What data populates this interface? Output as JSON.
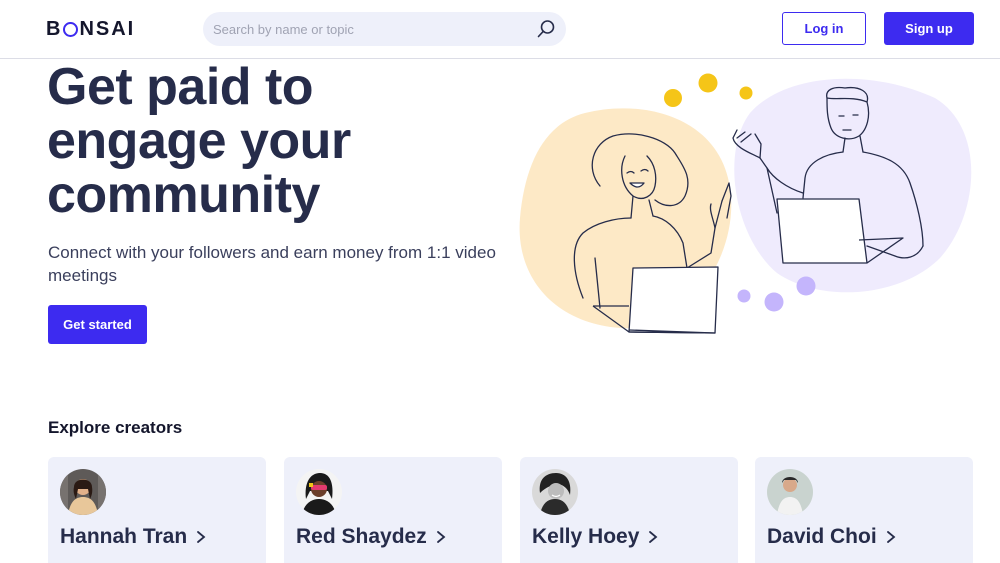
{
  "header": {
    "logo_pre": "B",
    "logo_post": "NSAI",
    "search_placeholder": "Search by name or topic",
    "login_label": "Log in",
    "signup_label": "Sign up"
  },
  "hero": {
    "title_line1": "Get paid to",
    "title_line2": "engage your",
    "title_line3": "community",
    "subtitle": "Connect with your followers and earn money from 1:1 video meetings",
    "cta_label": "Get started"
  },
  "explore": {
    "title": "Explore creators",
    "creators": [
      {
        "name": "Hannah Tran"
      },
      {
        "name": "Red Shaydez"
      },
      {
        "name": "Kelly Hoey"
      },
      {
        "name": "David Choi"
      }
    ]
  },
  "colors": {
    "accent": "#3d2bf0",
    "card_bg": "#eef0fa",
    "peach_blob": "#fde9c6",
    "lavender_blob": "#efebfd",
    "yellow_dot": "#f5c518",
    "purple_dot": "#c4b5fc"
  },
  "icons": {
    "search": "search-icon",
    "chevron": "chevron-right-icon"
  }
}
